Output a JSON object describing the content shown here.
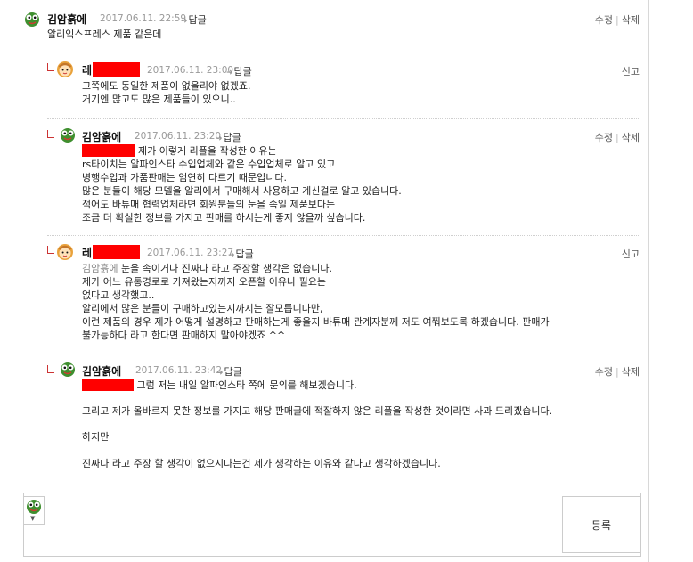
{
  "comments": [
    {
      "author": "김암흙에",
      "date": "2017.06.11. 22:59",
      "reply_label": "답글",
      "actions": [
        "수정",
        "삭제"
      ],
      "lines": [
        "알리익스프레스 제품 같은데"
      ]
    },
    {
      "author": "레",
      "author_redacted": true,
      "date": "2017.06.11. 23:00",
      "reply_label": "답글",
      "actions": [
        "신고"
      ],
      "lines": [
        "그쪽에도 동일한 제품이 없을리야 없겠죠.",
        "거기엔 많고도 많은 제품들이 있으니.."
      ]
    },
    {
      "author": "김암흙에",
      "date": "2017.06.11. 23:20",
      "reply_label": "답글",
      "actions": [
        "수정",
        "삭제"
      ],
      "first_line_after_redact": "제가 이렇게 리플을 작성한 이유는",
      "lines": [
        "rs타이치는 알파인스타 수입업체와 같은 수입업체로 알고 있고",
        "병행수입과 가품판매는 엄연히 다르기 때문입니다.",
        "많은 분들이 해당 모델을 알리에서 구매해서 사용하고 계신걸로 알고 있습니다.",
        "적어도 바튜매 협력업체라면 회원분들의 눈을 속일 제품보다는",
        "조금 더 확실한 정보를 가지고 판매를 하시는게 좋지 않을까 싶습니다."
      ]
    },
    {
      "author": "레",
      "author_redacted": true,
      "date": "2017.06.11. 23:27",
      "reply_label": "답글",
      "actions": [
        "신고"
      ],
      "mention": "김암흙에",
      "first_line_after_mention": " 눈을 속이거나 진짜다 라고 주장할 생각은 없습니다.",
      "lines": [
        "제가 어느 유통경로로 가져왔는지까지 오픈할 이유나 필요는",
        "없다고 생각했고..",
        "알리에서 많은 분들이 구매하고있는지까지는 잘모릅니다만,",
        "이런 제품의 경우 제가 어떻게 설명하고 판매하는게 좋을지 바튜매 관계자분께 저도 여쭤보도록 하겠습니다. 판매가",
        "불가능하다 라고 한다면 판매하지 말아야겠죠 ^^"
      ]
    },
    {
      "author": "김암흙에",
      "date": "2017.06.11. 23:42",
      "reply_label": "답글",
      "actions": [
        "수정",
        "삭제"
      ],
      "first_line_after_redact": " 그럼 저는 내일 알파인스타 쪽에 문의를 해보겠습니다.",
      "lines": [
        "",
        "그리고 제가 올바르지 못한 정보를 가지고 해당 판매글에 적잘하지 않은 리플을 작성한 것이라면 사과 드리겠습니다.",
        "",
        "하지만",
        "",
        "진짜다 라고 주장 할 생각이 없으시다는건 제가 생각하는 이유와 같다고 생각하겠습니다."
      ]
    }
  ],
  "composer": {
    "submit_label": "등록",
    "text": ""
  }
}
